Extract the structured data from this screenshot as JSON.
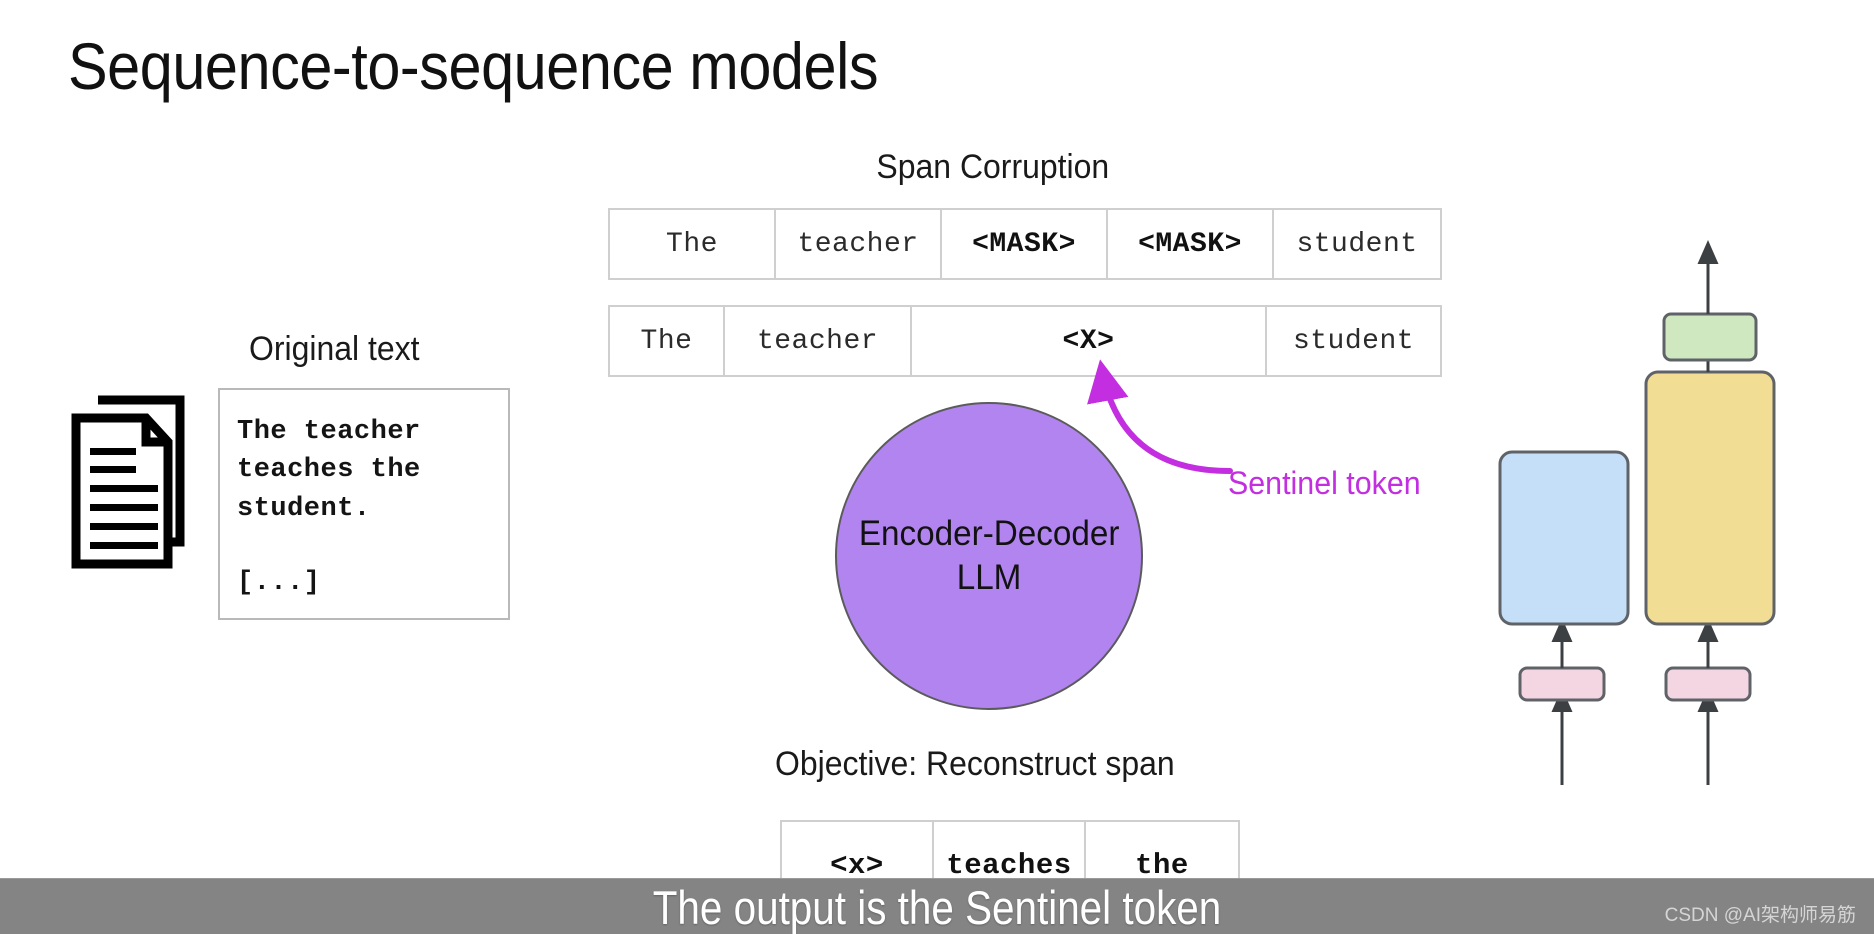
{
  "slide": {
    "title": "Sequence-to-sequence models",
    "background_color": "#ffffff"
  },
  "original_text": {
    "label": "Original text",
    "icon": "documents-icon",
    "body": "The teacher\nteaches the\nstudent.",
    "ellipsis": "[...]",
    "border_color": "#b9b9b9"
  },
  "span_corruption": {
    "label": "Span Corruption",
    "masked_row": {
      "name": "masked-token-row",
      "cells": [
        {
          "text": "The",
          "bold": false
        },
        {
          "text": "teacher",
          "bold": false
        },
        {
          "text": "<MASK>",
          "bold": true
        },
        {
          "text": "<MASK>",
          "bold": true
        },
        {
          "text": "student",
          "bold": false
        }
      ]
    },
    "sentinel_row": {
      "name": "sentinel-token-row",
      "cells": [
        {
          "text": "The",
          "bold": false
        },
        {
          "text": "teacher",
          "bold": false
        },
        {
          "text": "<X>",
          "bold": true
        },
        {
          "text": "student",
          "bold": false
        }
      ]
    },
    "table_border_color": "#cfcfcf"
  },
  "annotation": {
    "sentinel_label": "Sentinel token",
    "accent_color": "#c22ee0"
  },
  "model": {
    "line1": "Encoder-Decoder",
    "line2": "LLM",
    "fill_color": "#b184f0",
    "border_color": "#5b5b5b"
  },
  "objective": {
    "label": "Objective: Reconstruct span",
    "output_row": {
      "name": "reconstructed-span-row",
      "cells": [
        {
          "text": "<x>",
          "bold": true
        },
        {
          "text": "teaches",
          "bold": true
        },
        {
          "text": "the",
          "bold": true
        }
      ]
    }
  },
  "architecture": {
    "blocks": [
      {
        "name": "encoder-block",
        "color": "#c5dff8"
      },
      {
        "name": "decoder-block",
        "color": "#f2dd95"
      },
      {
        "name": "output-softmax-block",
        "color": "#cfe8c0"
      },
      {
        "name": "encoder-embedding-block",
        "color": "#f4d6e2"
      },
      {
        "name": "decoder-embedding-block",
        "color": "#f4d6e2"
      }
    ],
    "stroke_color": "#5f6368"
  },
  "caption": {
    "text": "The output is the Sentinel token",
    "bar_color": "#848484",
    "text_color": "#ffffff"
  },
  "watermark": {
    "text": "CSDN @AI架构师易筋"
  }
}
